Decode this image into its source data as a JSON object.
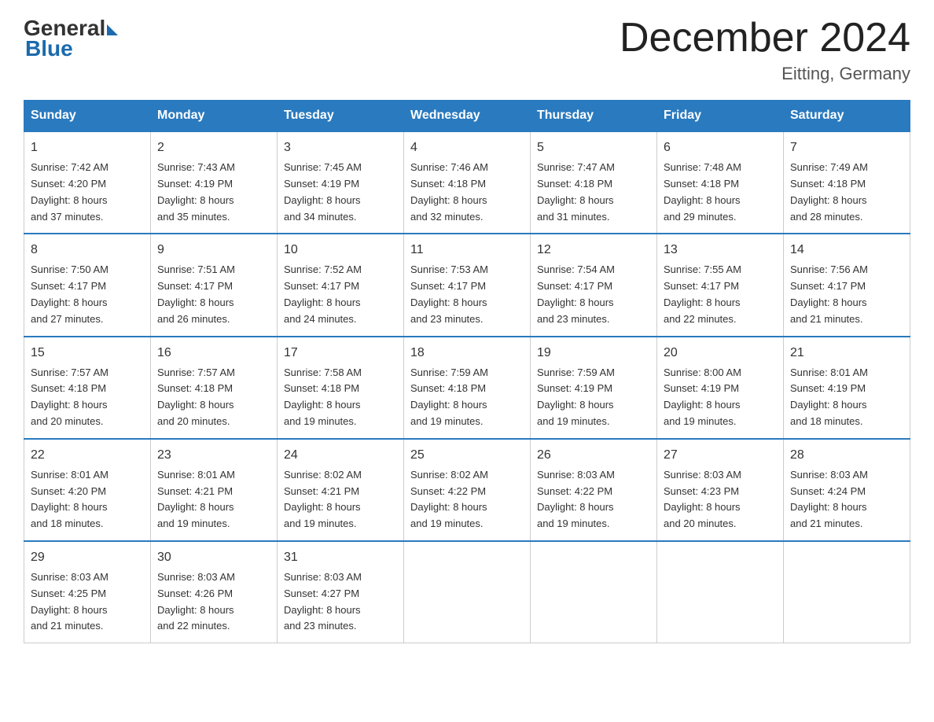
{
  "header": {
    "logo_general": "General",
    "logo_blue": "Blue",
    "month_title": "December 2024",
    "location": "Eitting, Germany"
  },
  "days_of_week": [
    "Sunday",
    "Monday",
    "Tuesday",
    "Wednesday",
    "Thursday",
    "Friday",
    "Saturday"
  ],
  "weeks": [
    [
      {
        "day": "1",
        "sunrise": "7:42 AM",
        "sunset": "4:20 PM",
        "daylight": "8 hours and 37 minutes."
      },
      {
        "day": "2",
        "sunrise": "7:43 AM",
        "sunset": "4:19 PM",
        "daylight": "8 hours and 35 minutes."
      },
      {
        "day": "3",
        "sunrise": "7:45 AM",
        "sunset": "4:19 PM",
        "daylight": "8 hours and 34 minutes."
      },
      {
        "day": "4",
        "sunrise": "7:46 AM",
        "sunset": "4:18 PM",
        "daylight": "8 hours and 32 minutes."
      },
      {
        "day": "5",
        "sunrise": "7:47 AM",
        "sunset": "4:18 PM",
        "daylight": "8 hours and 31 minutes."
      },
      {
        "day": "6",
        "sunrise": "7:48 AM",
        "sunset": "4:18 PM",
        "daylight": "8 hours and 29 minutes."
      },
      {
        "day": "7",
        "sunrise": "7:49 AM",
        "sunset": "4:18 PM",
        "daylight": "8 hours and 28 minutes."
      }
    ],
    [
      {
        "day": "8",
        "sunrise": "7:50 AM",
        "sunset": "4:17 PM",
        "daylight": "8 hours and 27 minutes."
      },
      {
        "day": "9",
        "sunrise": "7:51 AM",
        "sunset": "4:17 PM",
        "daylight": "8 hours and 26 minutes."
      },
      {
        "day": "10",
        "sunrise": "7:52 AM",
        "sunset": "4:17 PM",
        "daylight": "8 hours and 24 minutes."
      },
      {
        "day": "11",
        "sunrise": "7:53 AM",
        "sunset": "4:17 PM",
        "daylight": "8 hours and 23 minutes."
      },
      {
        "day": "12",
        "sunrise": "7:54 AM",
        "sunset": "4:17 PM",
        "daylight": "8 hours and 23 minutes."
      },
      {
        "day": "13",
        "sunrise": "7:55 AM",
        "sunset": "4:17 PM",
        "daylight": "8 hours and 22 minutes."
      },
      {
        "day": "14",
        "sunrise": "7:56 AM",
        "sunset": "4:17 PM",
        "daylight": "8 hours and 21 minutes."
      }
    ],
    [
      {
        "day": "15",
        "sunrise": "7:57 AM",
        "sunset": "4:18 PM",
        "daylight": "8 hours and 20 minutes."
      },
      {
        "day": "16",
        "sunrise": "7:57 AM",
        "sunset": "4:18 PM",
        "daylight": "8 hours and 20 minutes."
      },
      {
        "day": "17",
        "sunrise": "7:58 AM",
        "sunset": "4:18 PM",
        "daylight": "8 hours and 19 minutes."
      },
      {
        "day": "18",
        "sunrise": "7:59 AM",
        "sunset": "4:18 PM",
        "daylight": "8 hours and 19 minutes."
      },
      {
        "day": "19",
        "sunrise": "7:59 AM",
        "sunset": "4:19 PM",
        "daylight": "8 hours and 19 minutes."
      },
      {
        "day": "20",
        "sunrise": "8:00 AM",
        "sunset": "4:19 PM",
        "daylight": "8 hours and 19 minutes."
      },
      {
        "day": "21",
        "sunrise": "8:01 AM",
        "sunset": "4:19 PM",
        "daylight": "8 hours and 18 minutes."
      }
    ],
    [
      {
        "day": "22",
        "sunrise": "8:01 AM",
        "sunset": "4:20 PM",
        "daylight": "8 hours and 18 minutes."
      },
      {
        "day": "23",
        "sunrise": "8:01 AM",
        "sunset": "4:21 PM",
        "daylight": "8 hours and 19 minutes."
      },
      {
        "day": "24",
        "sunrise": "8:02 AM",
        "sunset": "4:21 PM",
        "daylight": "8 hours and 19 minutes."
      },
      {
        "day": "25",
        "sunrise": "8:02 AM",
        "sunset": "4:22 PM",
        "daylight": "8 hours and 19 minutes."
      },
      {
        "day": "26",
        "sunrise": "8:03 AM",
        "sunset": "4:22 PM",
        "daylight": "8 hours and 19 minutes."
      },
      {
        "day": "27",
        "sunrise": "8:03 AM",
        "sunset": "4:23 PM",
        "daylight": "8 hours and 20 minutes."
      },
      {
        "day": "28",
        "sunrise": "8:03 AM",
        "sunset": "4:24 PM",
        "daylight": "8 hours and 21 minutes."
      }
    ],
    [
      {
        "day": "29",
        "sunrise": "8:03 AM",
        "sunset": "4:25 PM",
        "daylight": "8 hours and 21 minutes."
      },
      {
        "day": "30",
        "sunrise": "8:03 AM",
        "sunset": "4:26 PM",
        "daylight": "8 hours and 22 minutes."
      },
      {
        "day": "31",
        "sunrise": "8:03 AM",
        "sunset": "4:27 PM",
        "daylight": "8 hours and 23 minutes."
      },
      null,
      null,
      null,
      null
    ]
  ],
  "labels": {
    "sunrise": "Sunrise:",
    "sunset": "Sunset:",
    "daylight": "Daylight:"
  }
}
